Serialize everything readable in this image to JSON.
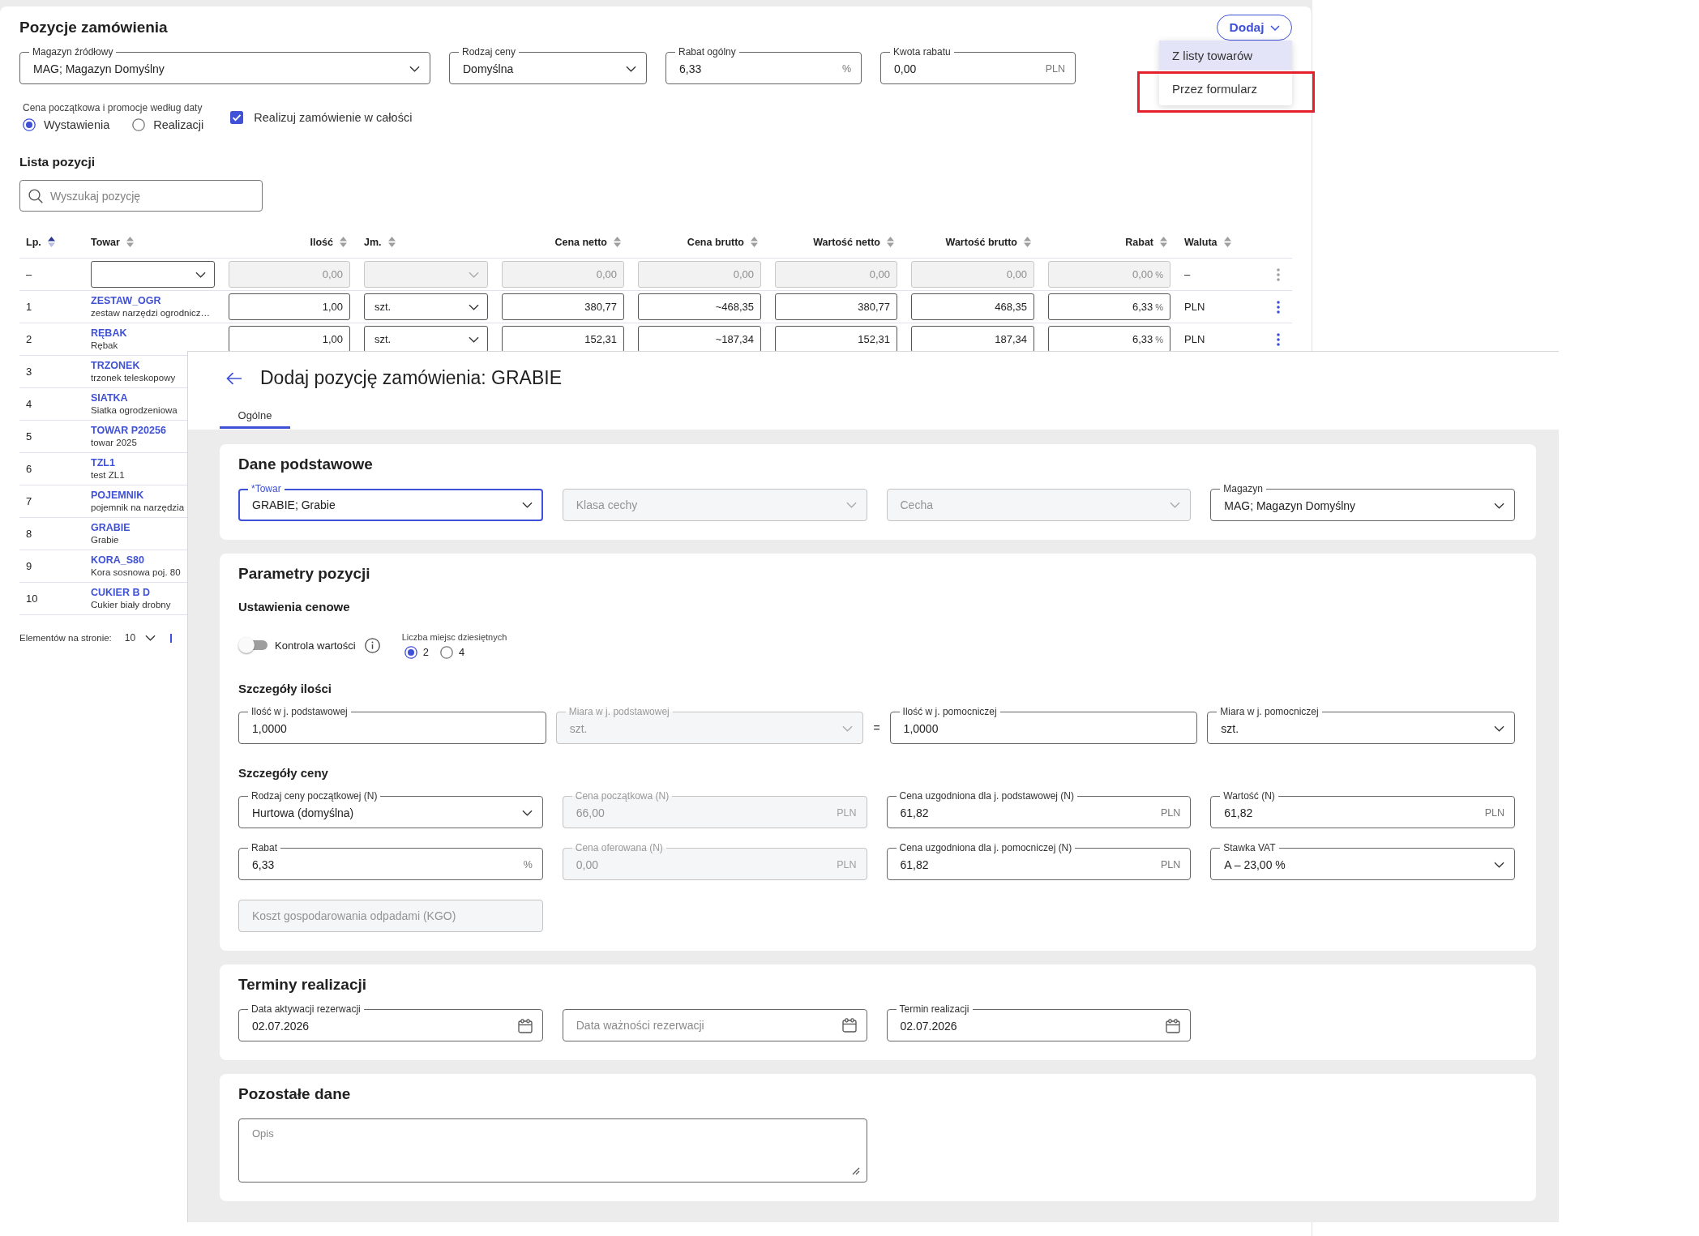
{
  "order": {
    "title": "Pozycje zamówienia",
    "add_button": {
      "label": "Dodaj"
    },
    "add_menu": [
      {
        "label": "Z listy towarów",
        "selected": true,
        "highlighted": false
      },
      {
        "label": "Przez formularz",
        "selected": false,
        "highlighted": true
      }
    ],
    "fields": [
      {
        "kind": "select",
        "label": "Magazyn źródłowy",
        "value": "MAG; Magazyn Domyślny"
      },
      {
        "kind": "select",
        "label": "Rodzaj ceny",
        "value": "Domyślna"
      },
      {
        "kind": "input",
        "label": "Rabat ogólny",
        "value": "6,33",
        "suffix": "%"
      },
      {
        "kind": "input",
        "label": "Kwota rabatu",
        "value": "0,00",
        "suffix": "PLN"
      }
    ],
    "date_basis": {
      "label": "Cena początkowa i promocje według daty",
      "options": [
        {
          "label": "Wystawienia",
          "selected": true
        },
        {
          "label": "Realizacji",
          "selected": false
        }
      ]
    },
    "full_order": {
      "label": "Realizuj zamówienie w całości",
      "checked": true
    },
    "list_title": "Lista pozycji",
    "search": {
      "placeholder": "Wyszukaj pozycję"
    },
    "table": {
      "columns": [
        {
          "label": "Lp.",
          "kind": "text",
          "sorted": true
        },
        {
          "label": "Towar",
          "kind": "text",
          "sorted": false
        },
        {
          "label": "Ilość",
          "kind": "number",
          "sorted": false
        },
        {
          "label": "Jm.",
          "kind": "text",
          "sorted": false
        },
        {
          "label": "Cena netto",
          "kind": "number",
          "sorted": false
        },
        {
          "label": "Cena brutto",
          "kind": "number",
          "sorted": false
        },
        {
          "label": "Wartość netto",
          "kind": "number",
          "sorted": false
        },
        {
          "label": "Wartość brutto",
          "kind": "number",
          "sorted": false
        },
        {
          "label": "Rabat",
          "kind": "number",
          "sorted": false
        },
        {
          "label": "Waluta",
          "kind": "text",
          "sorted": false
        }
      ],
      "filter_row": {
        "lp": "–",
        "ilosc": "0,00",
        "cena_netto": "0,00",
        "cena_brutto": "0,00",
        "wartosc_netto": "0,00",
        "wartosc_brutto": "0,00",
        "rabat": "0,00",
        "rabat_unit": "%",
        "waluta": "–",
        "disabled": true
      },
      "rows": [
        {
          "lp": "1",
          "code": "ZESTAW_OGR",
          "description": "zestaw narzędzi ogrodnicz…",
          "ilosc": "1,00",
          "jm": "szt.",
          "cena_netto": "380,77",
          "cena_brutto": "~468,35",
          "wartosc_netto": "380,77",
          "wartosc_brutto": "468,35",
          "rabat": "6,33",
          "rabat_unit": "%",
          "waluta": "PLN"
        },
        {
          "lp": "2",
          "code": "RĘBAK",
          "description": "Rębak",
          "ilosc": "1,00",
          "jm": "szt.",
          "cena_netto": "152,31",
          "cena_brutto": "~187,34",
          "wartosc_netto": "152,31",
          "wartosc_brutto": "187,34",
          "rabat": "6,33",
          "rabat_unit": "%",
          "waluta": "PLN"
        },
        {
          "lp": "3",
          "code": "TRZONEK",
          "description": "trzonek teleskopowy"
        },
        {
          "lp": "4",
          "code": "SIATKA",
          "description": "Siatka ogrodzeniowa"
        },
        {
          "lp": "5",
          "code": "TOWAR P20256",
          "description": "towar 2025"
        },
        {
          "lp": "6",
          "code": "TZL1",
          "description": "test ZL1"
        },
        {
          "lp": "7",
          "code": "POJEMNIK",
          "description": "pojemnik na narzędzia"
        },
        {
          "lp": "8",
          "code": "GRABIE",
          "description": "Grabie"
        },
        {
          "lp": "9",
          "code": "KORA_S80",
          "description": "Kora sosnowa poj. 80"
        },
        {
          "lp": "10",
          "code": "CUKIER B D",
          "description": "Cukier biały drobny"
        }
      ]
    },
    "pagination": {
      "label": "Elementów na stronie:",
      "page_size": "10"
    }
  },
  "dialog": {
    "title": "Dodaj pozycję zamówienia: GRABIE",
    "tabs": [
      {
        "label": "Ogólne",
        "selected": true
      }
    ],
    "sections": [
      {
        "kind": "fields",
        "title": "Dane podstawowe",
        "fields": [
          {
            "kind": "select",
            "label": "*Towar",
            "value": "GRABIE; Grabie",
            "disabled": false,
            "focused": true
          },
          {
            "kind": "select",
            "placeholder": "Klasa cechy",
            "disabled": true,
            "focused": false
          },
          {
            "kind": "select",
            "placeholder": "Cecha",
            "disabled": true,
            "focused": false
          },
          {
            "kind": "select",
            "label": "Magazyn",
            "value": "MAG; Magazyn Domyślny",
            "disabled": false,
            "focused": false
          }
        ]
      },
      {
        "kind": "parameters",
        "title": "Parametry pozycji",
        "groups": [
          {
            "kind": "price_settings",
            "title": "Ustawienia cenowe",
            "toggle": {
              "label": "Kontrola wartości",
              "on": false
            },
            "decimals": {
              "label": "Liczba miejsc dziesiętnych",
              "options": [
                {
                  "label": "2",
                  "selected": true
                },
                {
                  "label": "4",
                  "selected": false
                }
              ]
            }
          },
          {
            "kind": "fields",
            "title": "Szczegóły ilości",
            "fields": [
              {
                "kind": "input",
                "label": "Ilość w j. podstawowej",
                "value": "1,0000",
                "disabled": false,
                "focused": false
              },
              {
                "kind": "select",
                "label": "Miara w j. podstawowej",
                "value": "szt.",
                "disabled": true,
                "focused": false
              },
              {
                "kind": "sign",
                "text": "="
              },
              {
                "kind": "input",
                "label": "Ilość w j. pomocniczej",
                "value": "1,0000",
                "disabled": false,
                "focused": false
              },
              {
                "kind": "select",
                "label": "Miara w j. pomocniczej",
                "value": "szt.",
                "disabled": false,
                "focused": false
              }
            ]
          },
          {
            "kind": "fields",
            "title": "Szczegóły ceny",
            "fields": [
              {
                "kind": "select",
                "label": "Rodzaj ceny początkowej (N)",
                "value": "Hurtowa (domyślna)",
                "disabled": false,
                "focused": false
              },
              {
                "kind": "input",
                "label": "Cena początkowa (N)",
                "value": "66,00",
                "suffix": "PLN",
                "disabled": true,
                "focused": false
              },
              {
                "kind": "input",
                "label": "Cena uzgodniona dla j. podstawowej (N)",
                "value": "61,82",
                "suffix": "PLN",
                "disabled": false,
                "focused": false
              },
              {
                "kind": "input",
                "label": "Wartość (N)",
                "value": "61,82",
                "suffix": "PLN",
                "disabled": false,
                "focused": false
              },
              {
                "kind": "input",
                "label": "Rabat",
                "value": "6,33",
                "suffix": "%",
                "disabled": false,
                "focused": false
              },
              {
                "kind": "input",
                "label": "Cena oferowana (N)",
                "value": "0,00",
                "suffix": "PLN",
                "disabled": true,
                "focused": false
              },
              {
                "kind": "input",
                "label": "Cena uzgodniona dla j. pomocniczej (N)",
                "value": "61,82",
                "suffix": "PLN",
                "disabled": false,
                "focused": false
              },
              {
                "kind": "select",
                "label": "Stawka VAT",
                "value": "A – 23,00 %",
                "disabled": false,
                "focused": false
              },
              {
                "kind": "input",
                "placeholder": "Koszt gospodarowania odpadami (KGO)",
                "disabled": true,
                "focused": false
              }
            ]
          }
        ]
      },
      {
        "kind": "fields",
        "title": "Terminy realizacji",
        "fields": [
          {
            "kind": "date",
            "label": "Data aktywacji rezerwacji",
            "value": "02.07.2026",
            "disabled": false,
            "focused": false
          },
          {
            "kind": "date",
            "placeholder": "Data ważności rezerwacji",
            "disabled": false,
            "focused": false
          },
          {
            "kind": "date",
            "label": "Termin realizacji",
            "value": "02.07.2026",
            "disabled": false,
            "focused": false
          }
        ]
      },
      {
        "kind": "fields",
        "title": "Pozostałe dane",
        "fields": [
          {
            "kind": "textarea",
            "placeholder": "Opis",
            "disabled": false,
            "focused": false
          }
        ]
      }
    ]
  }
}
